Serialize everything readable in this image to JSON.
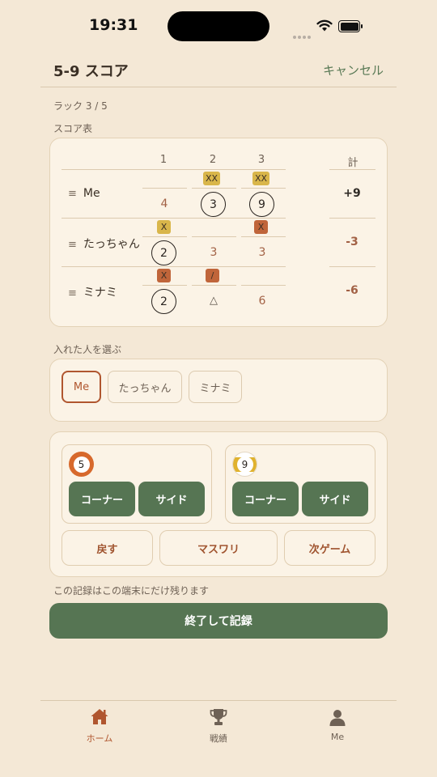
{
  "status_bar": {
    "time": "19:31"
  },
  "header": {
    "title": "5-9 スコア",
    "cancel_label": "キャンセル"
  },
  "rack_info": "ラック 3 / 5",
  "scoreboard": {
    "label": "スコア表",
    "columns": [
      "1",
      "2",
      "3"
    ],
    "total_label": "計",
    "players": [
      {
        "name": "Me",
        "marks": [
          "",
          "XX",
          "XX"
        ],
        "scores": [
          "4",
          "3",
          "9"
        ],
        "circled": [
          false,
          true,
          true
        ],
        "total": "+9"
      },
      {
        "name": "たっちゃん",
        "marks": [
          "X",
          "",
          "X"
        ],
        "scores": [
          "2",
          "3",
          "3"
        ],
        "circled": [
          true,
          false,
          false
        ],
        "total": "-3"
      },
      {
        "name": "ミナミ",
        "marks": [
          "X",
          "/",
          ""
        ],
        "scores": [
          "2",
          "△",
          "6"
        ],
        "circled": [
          true,
          false,
          false
        ],
        "total": "-6"
      }
    ]
  },
  "picker": {
    "label": "入れた人を選ぶ",
    "options": [
      "Me",
      "たっちゃん",
      "ミナミ"
    ],
    "selected": "Me"
  },
  "balls": [
    {
      "number": "5",
      "corner_label": "コーナー",
      "side_label": "サイド",
      "color": "#d7692c"
    },
    {
      "number": "9",
      "corner_label": "コーナー",
      "side_label": "サイド",
      "color": "#e0b22e"
    }
  ],
  "actions": {
    "undo_label": "戻す",
    "scratch_label": "マスワリ",
    "next_game_label": "次ゲーム"
  },
  "local_note": "この記録はこの端末にだけ残ります",
  "finish_label": "終了して記録",
  "tabs": [
    {
      "label": "ホーム",
      "icon": "home-icon",
      "active": true
    },
    {
      "label": "戦績",
      "icon": "trophy-icon",
      "active": false
    },
    {
      "label": "Me",
      "icon": "person-icon",
      "active": false
    }
  ],
  "colors": {
    "accent": "#b0562f",
    "primary_green": "#567553",
    "background": "#f4e8d6"
  }
}
